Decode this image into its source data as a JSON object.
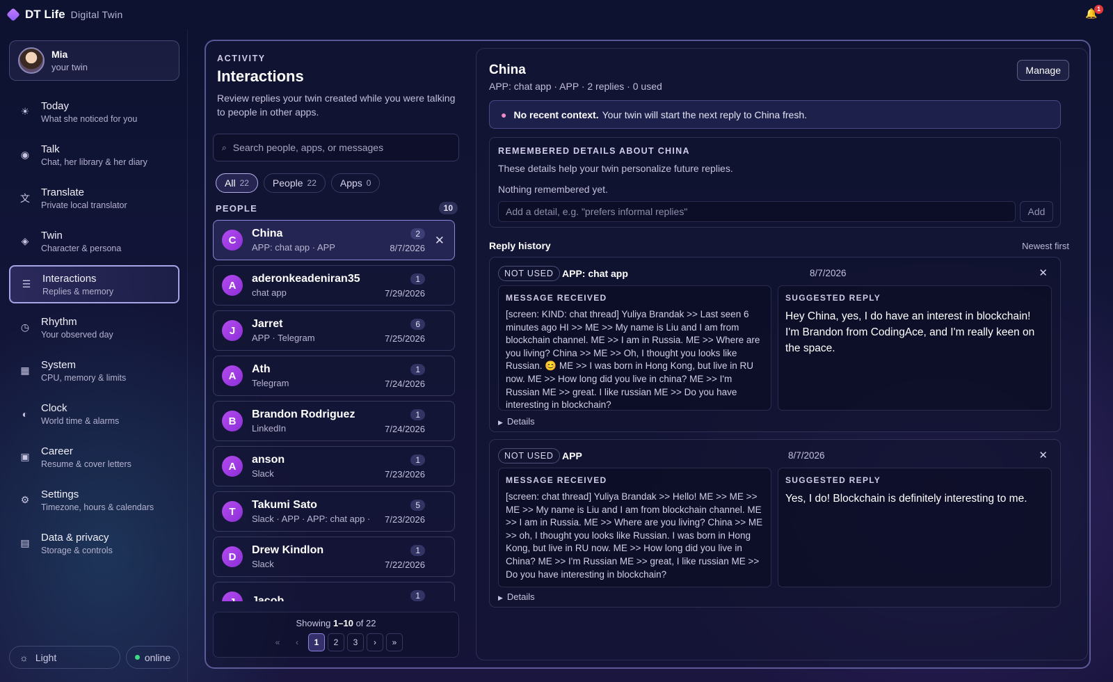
{
  "app": {
    "brand": "DT Life",
    "subtitle": "Digital Twin",
    "notif_count": "1"
  },
  "profile": {
    "name": "Mia",
    "sub": "your twin"
  },
  "nav": [
    {
      "title": "Today",
      "sub": "What she noticed for you",
      "icon": "☀"
    },
    {
      "title": "Talk",
      "sub": "Chat, her library & her diary",
      "icon": "◉"
    },
    {
      "title": "Translate",
      "sub": "Private local translator",
      "icon": "文"
    },
    {
      "title": "Twin",
      "sub": "Character & persona",
      "icon": "◈"
    },
    {
      "title": "Interactions",
      "sub": "Replies & memory",
      "icon": "☰"
    },
    {
      "title": "Rhythm",
      "sub": "Your observed day",
      "icon": "◷"
    },
    {
      "title": "System",
      "sub": "CPU, memory & limits",
      "icon": "▦"
    },
    {
      "title": "Clock",
      "sub": "World time & alarms",
      "icon": "◐"
    },
    {
      "title": "Career",
      "sub": "Resume & cover letters",
      "icon": "▣"
    },
    {
      "title": "Settings",
      "sub": "Timezone, hours & calendars",
      "icon": "⚙"
    },
    {
      "title": "Data & privacy",
      "sub": "Storage & controls",
      "icon": "▤"
    }
  ],
  "footer": {
    "theme": "Light",
    "status": "online"
  },
  "activity": {
    "eyebrow": "ACTIVITY",
    "title": "Interactions",
    "desc": "Review replies your twin created while you were talking to people in other apps.",
    "search_placeholder": "Search people, apps, or messages",
    "filters": [
      {
        "label": "All",
        "count": "22"
      },
      {
        "label": "People",
        "count": "22"
      },
      {
        "label": "Apps",
        "count": "0"
      }
    ],
    "people_label": "PEOPLE",
    "people_count": "10",
    "people": [
      {
        "initial": "C",
        "name": "China",
        "sub": "APP: chat app · APP",
        "count": "2",
        "date": "8/7/2026"
      },
      {
        "initial": "A",
        "name": "aderonkeadeniran35",
        "sub": "chat app",
        "count": "1",
        "date": "7/29/2026"
      },
      {
        "initial": "J",
        "name": "Jarret",
        "sub": "APP · Telegram",
        "count": "6",
        "date": "7/25/2026"
      },
      {
        "initial": "A",
        "name": "Ath",
        "sub": "Telegram",
        "count": "1",
        "date": "7/24/2026"
      },
      {
        "initial": "B",
        "name": "Brandon Rodriguez",
        "sub": "LinkedIn",
        "count": "1",
        "date": "7/24/2026"
      },
      {
        "initial": "A",
        "name": "anson",
        "sub": "Slack",
        "count": "1",
        "date": "7/23/2026"
      },
      {
        "initial": "T",
        "name": "Takumi Sato",
        "sub": "Slack · APP · APP: chat app · ...",
        "count": "5",
        "date": "7/23/2026"
      },
      {
        "initial": "D",
        "name": "Drew Kindlon",
        "sub": "Slack",
        "count": "1",
        "date": "7/22/2026"
      },
      {
        "initial": "J",
        "name": "Jacob",
        "sub": "",
        "count": "1",
        "date": ""
      }
    ],
    "showing_pre": "Showing",
    "showing_range": "1–10",
    "showing_post": "of 22",
    "pages": [
      "«",
      "‹",
      "1",
      "2",
      "3",
      "›",
      "»"
    ]
  },
  "detail": {
    "title": "China",
    "meta": "APP: chat app · APP · 2 replies · 0 used",
    "manage": "Manage",
    "ctx_bold": "No recent context.",
    "ctx_text": "Your twin will start the next reply to China fresh.",
    "remember_head": "REMEMBERED DETAILS ABOUT CHINA",
    "remember_desc": "These details help your twin personalize future replies.",
    "remember_empty": "Nothing remembered yet.",
    "remember_placeholder": "Add a detail, e.g. \"prefers informal replies\"",
    "remember_add": "Add",
    "history_title": "Reply history",
    "history_sort": "Newest first",
    "cards": [
      {
        "badge": "NOT USED",
        "source": "APP: chat app",
        "date": "8/7/2026",
        "received_head": "MESSAGE RECEIVED",
        "received": "[screen: KIND: chat thread] Yuliya Brandak >> Last seen 6 minutes ago HI >> ME >> My name is Liu and I am from blockchain channel. ME >> I am in Russia. ME >> Where are you living? China >> ME >> Oh, I thought you looks like Russian. 😊 ME >> I was born in Hong Kong, but live in RU now. ME >> How long did you live in china? ME >> I'm Russian ME >> great. I like russian ME >> Do you have interesting in blockchain?",
        "reply_head": "SUGGESTED REPLY",
        "reply": "Hey China, yes, I do have an interest in blockchain! I'm Brandon from CodingAce, and I'm really keen on the space.",
        "details": "Details"
      },
      {
        "badge": "NOT USED",
        "source": "APP",
        "date": "8/7/2026",
        "received_head": "MESSAGE RECEIVED",
        "received": "[screen: chat thread] Yuliya Brandak >> Hello! ME >> ME >> ME >> My name is Liu and I am from blockchain channel. ME >> I am in Russia. ME >> Where are you living? China >> ME >> oh, I thought you looks like Russian. I was born in Hong Kong, but live in RU now. ME >> How long did you live in China? ME >> I'm Russian ME >> great, I like russian ME >> Do you have interesting in blockchain?",
        "reply_head": "SUGGESTED REPLY",
        "reply": "Yes, I do! Blockchain is definitely interesting to me.",
        "details": "Details"
      }
    ]
  }
}
